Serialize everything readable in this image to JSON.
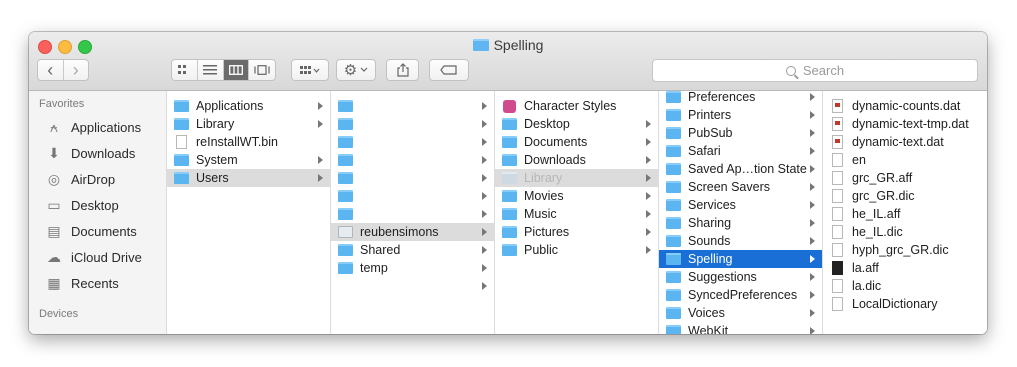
{
  "window": {
    "title": "Spelling"
  },
  "toolbar": {
    "back_glyph": "‹",
    "forward_glyph": "›",
    "view_modes": [
      "icon-view",
      "list-view",
      "column-view",
      "cover-flow-view"
    ],
    "active_view": "column-view",
    "share_glyph": "⇪",
    "search_placeholder": "Search"
  },
  "sidebar": {
    "favorites_header": "Favorites",
    "devices_header": "Devices",
    "favorites": [
      {
        "label": "Applications",
        "icon": "applications-icon"
      },
      {
        "label": "Downloads",
        "icon": "downloads-icon"
      },
      {
        "label": "AirDrop",
        "icon": "airdrop-icon"
      },
      {
        "label": "Desktop",
        "icon": "desktop-icon"
      },
      {
        "label": "Documents",
        "icon": "documents-icon"
      },
      {
        "label": "iCloud Drive",
        "icon": "icloud-icon"
      },
      {
        "label": "Recents",
        "icon": "recents-icon"
      }
    ]
  },
  "columns": [
    {
      "items": [
        {
          "label": "Applications",
          "icon": "sysfolder",
          "arrow": true
        },
        {
          "label": "Library",
          "icon": "sysfolder",
          "arrow": true
        },
        {
          "label": "reInstallWT.bin",
          "icon": "doc",
          "arrow": false
        },
        {
          "label": "System",
          "icon": "sysfolder",
          "arrow": true
        },
        {
          "label": "Users",
          "icon": "sysfolder",
          "arrow": true,
          "state": "selected"
        }
      ]
    },
    {
      "items": [
        {
          "label": "",
          "icon": "folder",
          "arrow": true
        },
        {
          "label": "",
          "icon": "folder",
          "arrow": true
        },
        {
          "label": "",
          "icon": "folder",
          "arrow": true
        },
        {
          "label": "",
          "icon": "folder",
          "arrow": true
        },
        {
          "label": "",
          "icon": "folder",
          "arrow": true
        },
        {
          "label": "",
          "icon": "folder",
          "arrow": true
        },
        {
          "label": "",
          "icon": "folder",
          "arrow": true
        },
        {
          "label": "reubensimons",
          "icon": "home",
          "arrow": true,
          "state": "selected"
        },
        {
          "label": "Shared",
          "icon": "folder",
          "arrow": true
        },
        {
          "label": "temp",
          "icon": "folder",
          "arrow": true
        },
        {
          "label": "",
          "icon": "none",
          "arrow": true
        }
      ]
    },
    {
      "items": [
        {
          "label": "Character Styles",
          "icon": "app",
          "arrow": false
        },
        {
          "label": "Desktop",
          "icon": "folder",
          "arrow": true
        },
        {
          "label": "Documents",
          "icon": "folder",
          "arrow": true
        },
        {
          "label": "Downloads",
          "icon": "folder",
          "arrow": true
        },
        {
          "label": "Library",
          "icon": "grey",
          "arrow": true,
          "state": "dim-selected"
        },
        {
          "label": "Movies",
          "icon": "folder",
          "arrow": true
        },
        {
          "label": "Music",
          "icon": "folder",
          "arrow": true
        },
        {
          "label": "Pictures",
          "icon": "folder",
          "arrow": true
        },
        {
          "label": "Public",
          "icon": "folder",
          "arrow": true
        }
      ]
    },
    {
      "items": [
        {
          "label": "Preferences",
          "icon": "folder",
          "arrow": true
        },
        {
          "label": "Printers",
          "icon": "folder",
          "arrow": true
        },
        {
          "label": "PubSub",
          "icon": "folder",
          "arrow": true
        },
        {
          "label": "Safari",
          "icon": "folder",
          "arrow": true
        },
        {
          "label": "Saved Ap…tion State",
          "icon": "folder",
          "arrow": true
        },
        {
          "label": "Screen Savers",
          "icon": "folder",
          "arrow": true
        },
        {
          "label": "Services",
          "icon": "folder",
          "arrow": true
        },
        {
          "label": "Sharing",
          "icon": "folder",
          "arrow": true
        },
        {
          "label": "Sounds",
          "icon": "folder",
          "arrow": true
        },
        {
          "label": "Spelling",
          "icon": "folder",
          "arrow": true,
          "state": "active"
        },
        {
          "label": "Suggestions",
          "icon": "folder",
          "arrow": true
        },
        {
          "label": "SyncedPreferences",
          "icon": "folder",
          "arrow": true
        },
        {
          "label": "Voices",
          "icon": "folder",
          "arrow": true
        },
        {
          "label": "WebKit",
          "icon": "folder",
          "arrow": true
        }
      ]
    },
    {
      "items": [
        {
          "label": "dynamic-counts.dat",
          "icon": "dat",
          "arrow": false
        },
        {
          "label": "dynamic-text-tmp.dat",
          "icon": "dat",
          "arrow": false
        },
        {
          "label": "dynamic-text.dat",
          "icon": "dat",
          "arrow": false
        },
        {
          "label": "en",
          "icon": "doc",
          "arrow": false
        },
        {
          "label": "grc_GR.aff",
          "icon": "doc",
          "arrow": false
        },
        {
          "label": "grc_GR.dic",
          "icon": "doc",
          "arrow": false
        },
        {
          "label": "he_IL.aff",
          "icon": "doc",
          "arrow": false
        },
        {
          "label": "he_IL.dic",
          "icon": "doc",
          "arrow": false
        },
        {
          "label": "hyph_grc_GR.dic",
          "icon": "doc",
          "arrow": false
        },
        {
          "label": "la.aff",
          "icon": "black",
          "arrow": false
        },
        {
          "label": "la.dic",
          "icon": "doc",
          "arrow": false
        },
        {
          "label": "LocalDictionary",
          "icon": "doc",
          "arrow": false
        }
      ]
    }
  ]
}
